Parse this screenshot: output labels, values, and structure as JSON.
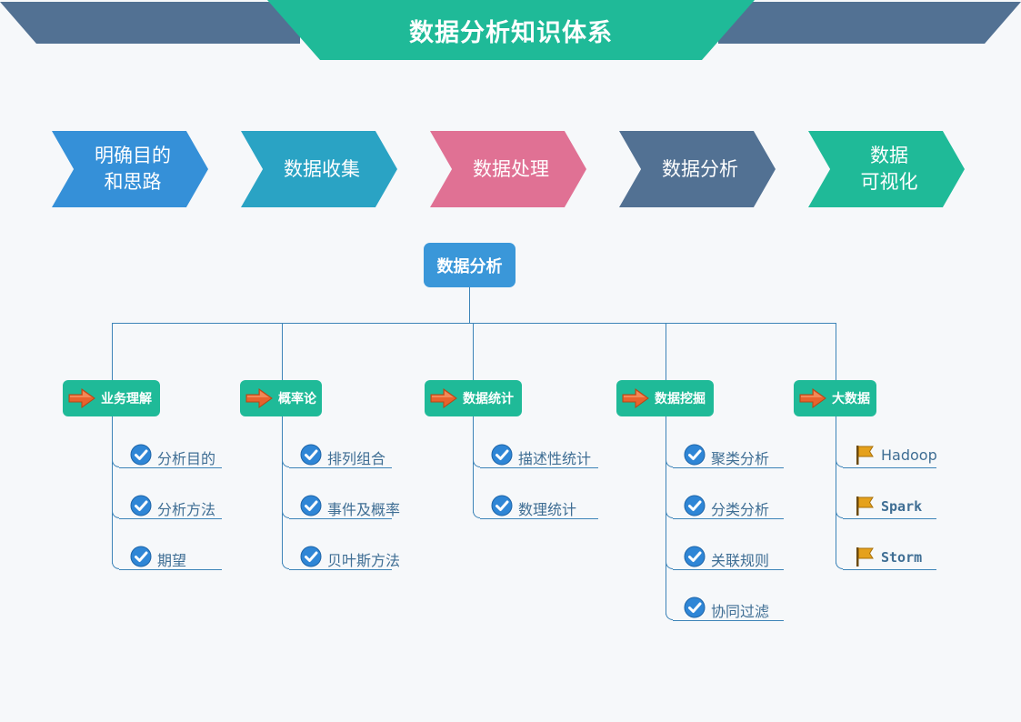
{
  "title": "数据分析知识体系",
  "steps": [
    {
      "label": "明确目的\n和思路",
      "color": "#3590d8"
    },
    {
      "label": "数据收集",
      "color": "#2aa3c4"
    },
    {
      "label": "数据处理",
      "color": "#e07194"
    },
    {
      "label": "数据分析",
      "color": "#527193"
    },
    {
      "label": "数据\n可视化",
      "color": "#1fba98"
    }
  ],
  "root": "数据分析",
  "branches": [
    {
      "label": "业务理解",
      "items": [
        "分析目的",
        "分析方法",
        "期望"
      ]
    },
    {
      "label": "概率论",
      "items": [
        "排列组合",
        "事件及概率",
        "贝叶斯方法"
      ]
    },
    {
      "label": "数据统计",
      "items": [
        "描述性统计",
        "数理统计"
      ]
    },
    {
      "label": "数据挖掘",
      "items": [
        "聚类分析",
        "分类分析",
        "关联规则",
        "协同过滤"
      ]
    },
    {
      "label": "大数据",
      "items": [
        "Hadoop",
        "Spark",
        "Storm"
      ]
    }
  ],
  "icons": {
    "check": "check-circle-icon",
    "flag": "flag-icon",
    "arrow": "arrow-right-icon"
  }
}
